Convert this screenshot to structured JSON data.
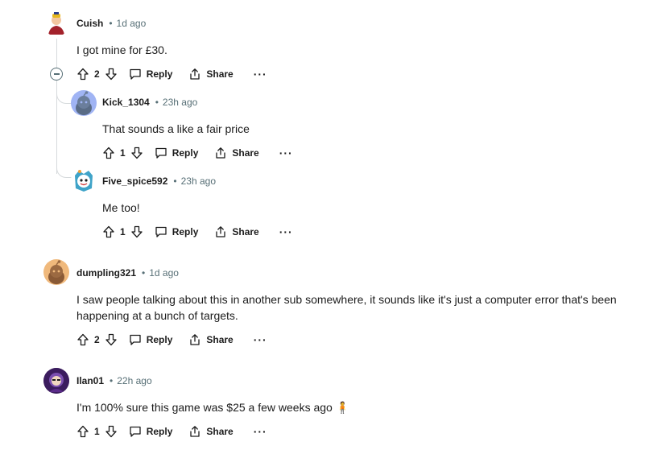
{
  "comments": [
    {
      "author": "Cuish",
      "time": "1d ago",
      "text": "I got mine for £30.",
      "votes": "2",
      "reply_label": "Reply",
      "share_label": "Share",
      "more_label": "···"
    },
    {
      "author": "Kick_1304",
      "time": "23h ago",
      "text": "That sounds a like a fair price",
      "votes": "1",
      "reply_label": "Reply",
      "share_label": "Share",
      "more_label": "···"
    },
    {
      "author": "Five_spice592",
      "time": "23h ago",
      "text": "Me too!",
      "votes": "1",
      "reply_label": "Reply",
      "share_label": "Share",
      "more_label": "···"
    },
    {
      "author": "dumpling321",
      "time": "1d ago",
      "text": "I saw people talking about this in another sub somewhere, it sounds like it's just a computer error that's been happening at a bunch of targets.",
      "votes": "2",
      "reply_label": "Reply",
      "share_label": "Share",
      "more_label": "···"
    },
    {
      "author": "Ilan01",
      "time": "22h ago",
      "text": "I'm 100% sure this game was $25 a few weeks ago 🧍",
      "votes": "1",
      "reply_label": "Reply",
      "share_label": "Share",
      "more_label": "···"
    }
  ],
  "meta_separator": "•",
  "icons": {
    "upvote": "arrow-up-outline",
    "downvote": "arrow-down-outline",
    "reply": "speech-bubble-outline",
    "share": "share-arrow-outline",
    "collapse": "minus-circle"
  },
  "colors": {
    "meta_gray": "#576f76",
    "thread_line": "#d6dadc",
    "avatar_blue": "#a0b4f4",
    "avatar_orange": "#f0b97c"
  }
}
